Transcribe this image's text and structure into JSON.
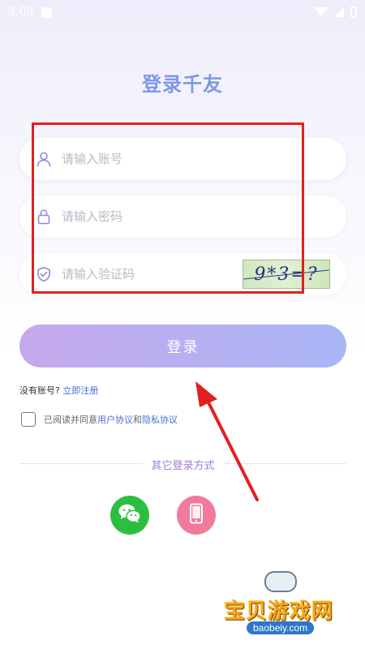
{
  "status_bar": {
    "time": "3:09"
  },
  "title": "登录千友",
  "form": {
    "account_placeholder": "请输入账号",
    "password_placeholder": "请输入密码",
    "captcha_placeholder": "请输入验证码",
    "captcha_text": "9*3=?"
  },
  "login_button": "登录",
  "register": {
    "prompt": "没有账号?",
    "link": "立即注册"
  },
  "agreement": {
    "prefix": "已阅读并同意",
    "user_agreement": "用户协议",
    "and": "和",
    "privacy_policy": "隐私协议",
    "checked": false
  },
  "other_login": {
    "label": "其它登录方式",
    "options": [
      "wechat-icon",
      "phone-icon"
    ]
  },
  "watermark": {
    "name": "宝贝游戏网",
    "url": "baobeiy.com"
  },
  "colors": {
    "title": "#7f97e6",
    "button_start": "#c5a9ec",
    "button_end": "#a9b5f6",
    "icon_purple": "#9b84d8",
    "link": "#4a6fd6",
    "wechat": "#2cbf3f",
    "phone": "#f07a9a",
    "annotation_red": "#e02020"
  }
}
